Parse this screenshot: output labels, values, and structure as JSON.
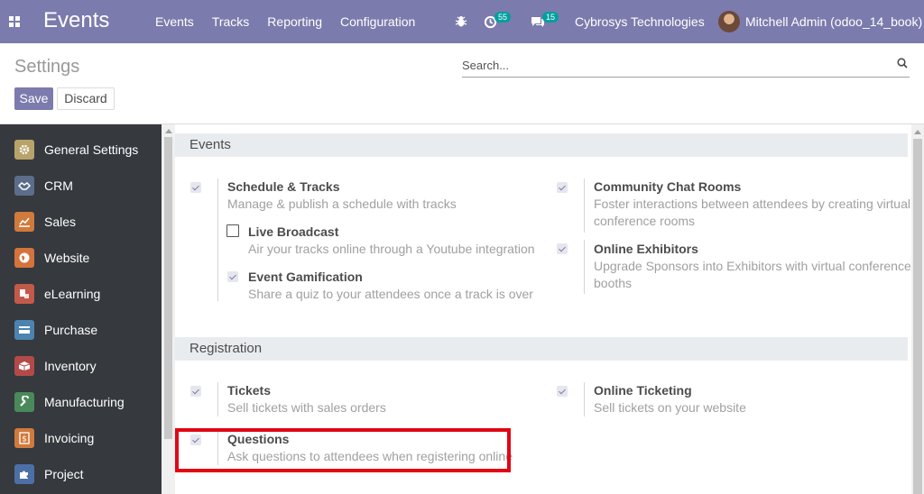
{
  "navbar": {
    "app_title": "Events",
    "menu": [
      "Events",
      "Tracks",
      "Reporting",
      "Configuration"
    ],
    "activity_count": "55",
    "message_count": "15",
    "company": "Cybrosys Technologies",
    "user": "Mitchell Admin (odoo_14_book)",
    "icons": [
      "apps-grid-icon",
      "bug-icon",
      "activity-clock-icon",
      "chat-bubble-icon"
    ]
  },
  "control_panel": {
    "title": "Settings",
    "save_label": "Save",
    "discard_label": "Discard",
    "search_placeholder": "Search..."
  },
  "sidebar": {
    "items": [
      {
        "label": "General Settings",
        "icon": "gear-icon",
        "color": "#b8a36a"
      },
      {
        "label": "CRM",
        "icon": "crm-handshake-icon",
        "color": "#5b6d8a"
      },
      {
        "label": "Sales",
        "icon": "sales-chart-icon",
        "color": "#d07a3c"
      },
      {
        "label": "Website",
        "icon": "globe-icon",
        "color": "#d4733d"
      },
      {
        "label": "eLearning",
        "icon": "elearning-icon",
        "color": "#c25a4a"
      },
      {
        "label": "Purchase",
        "icon": "purchase-card-icon",
        "color": "#4c83b0"
      },
      {
        "label": "Inventory",
        "icon": "inventory-box-icon",
        "color": "#b44a48"
      },
      {
        "label": "Manufacturing",
        "icon": "wrench-icon",
        "color": "#4a8a5a"
      },
      {
        "label": "Invoicing",
        "icon": "invoice-dollar-icon",
        "color": "#d07a3c"
      },
      {
        "label": "Project",
        "icon": "puzzle-icon",
        "color": "#4c6fa6"
      }
    ]
  },
  "sections": {
    "events": {
      "title": "Events",
      "schedule_tracks": {
        "title": "Schedule & Tracks",
        "desc": "Manage & publish a schedule with tracks",
        "checked": true
      },
      "live_broadcast": {
        "title": "Live Broadcast",
        "desc": "Air your tracks online through a Youtube integration",
        "checked": false
      },
      "event_gamification": {
        "title": "Event Gamification",
        "desc": "Share a quiz to your attendees once a track is over",
        "checked": true
      },
      "community_chat": {
        "title": "Community Chat Rooms",
        "desc_1": "Foster interactions between attendees by creating virtual",
        "desc_2": "conference rooms",
        "checked": true
      },
      "online_exhibitors": {
        "title": "Online Exhibitors",
        "desc_1": "Upgrade Sponsors into Exhibitors with virtual conference",
        "desc_2": "booths",
        "checked": true
      }
    },
    "registration": {
      "title": "Registration",
      "tickets": {
        "title": "Tickets",
        "desc": "Sell tickets with sales orders",
        "checked": true
      },
      "online_ticketing": {
        "title": "Online Ticketing",
        "desc": "Sell tickets on your website",
        "checked": true
      },
      "questions": {
        "title": "Questions",
        "desc": "Ask questions to attendees when registering online",
        "checked": true
      }
    }
  },
  "colors": {
    "brand": "#7c7bad",
    "sidebar": "#36393e",
    "highlight": "#e10613"
  }
}
